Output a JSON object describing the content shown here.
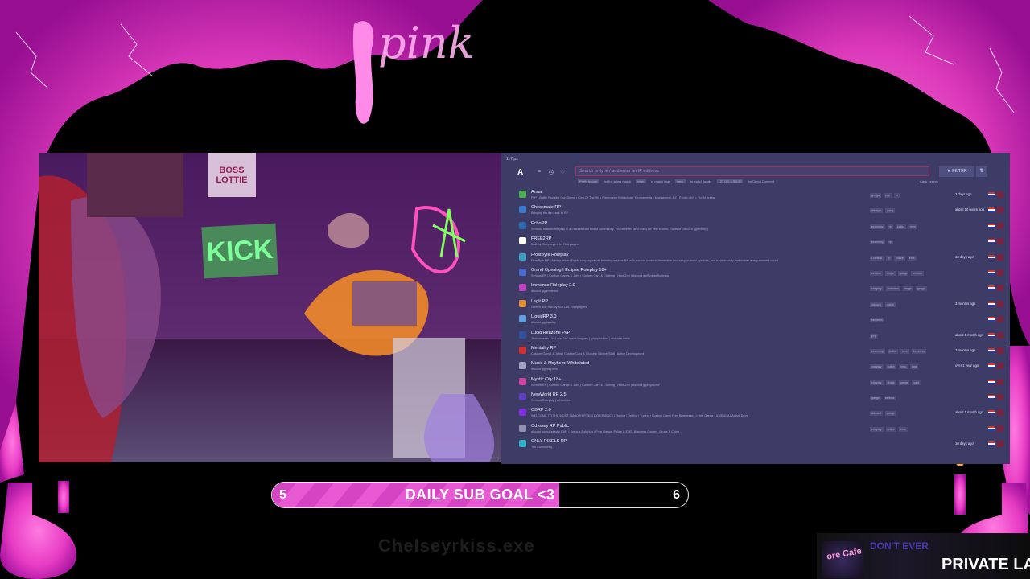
{
  "panel": {
    "fps_text": "117fps",
    "logo_glyph": "A",
    "search_placeholder": "Search or type / and enter an IP address",
    "hint_1_key": "Prefix ip:port",
    "hint_1_text": "for full string match",
    "hint_2_key": "tags:",
    "hint_2_text": "to match tags",
    "hint_3_key": "lang:",
    "hint_3_text": "to match locale",
    "hint_4_key": "127.0.0.1:30120",
    "hint_4_text": "for Direct Connect",
    "clear_label": "Clear search",
    "filter_label": "▼ FILTER",
    "sort_glyph": "⇅"
  },
  "servers": [
    {
      "name": "Arma",
      "desc": "PvP • Battle Royale • Gun Game • King Of The Hill • Freeroam • Extraction • Tournaments • Minigames • RZ • Exotic • KR • FiveM Arena",
      "tags": [
        "gunga",
        "pvp",
        "br"
      ],
      "time": "2 days ago",
      "color": "#4caf50"
    },
    {
      "name": "Checkmate RP",
      "desc": "Bringing the fun back to RP",
      "tags": [
        "lifestyle",
        "gang"
      ],
      "time": "about 10 hours ago",
      "color": "#3a7ad0"
    },
    {
      "name": "EchoRP",
      "desc": "Serious, realistic roleplay in an established FiveM community. You're vetted and ready for new stories. Roots of (discord.gg/echorp)",
      "tags": [
        "economy",
        "rp",
        "police",
        "ems"
      ],
      "time": "",
      "color": "#2a6ab0"
    },
    {
      "name": "FREE2RP",
      "desc": "Built by Roleplayers for Roleplayers",
      "tags": [
        "economy",
        "rp"
      ],
      "time": "",
      "color": "#ffffff"
    },
    {
      "name": "FrostByte Roleplay",
      "desc": "FrostByte RP | A story-driven FiveM roleplay server blending serious RP with custom content. Immersive economy, custom systems, and a community that makes every moment count",
      "tags": [
        "Criminal",
        "rp",
        "police",
        "ems"
      ],
      "time": "13 days ago",
      "color": "#3aa0c0"
    },
    {
      "name": "Grand OpeningII Eclipse Roleplay 18+",
      "desc": "Serious RP | Custom Gangs & Jobs | Custom Cars & Clothing | Hunt Zon | discord.gg/EclipseRoleplay",
      "tags": [
        "serious",
        "drugs",
        "gangs",
        "serious"
      ],
      "time": "",
      "color": "#4a6ad0"
    },
    {
      "name": "Immense Roleplay 2.0",
      "desc": "discord.gg/immense",
      "tags": [
        "roleplay",
        "business",
        "drugs",
        "gangs"
      ],
      "time": "",
      "color": "#c040c0"
    },
    {
      "name": "Legit RP",
      "desc": "Owned and Ran by ACTUAL Roleplayers",
      "tags": [
        "discord",
        "police"
      ],
      "time": "3 months ago",
      "color": "#e09030"
    },
    {
      "name": "LiquidRP 3.0",
      "desc": "discord.gg/liquidrp",
      "tags": [
        "fair rules"
      ],
      "time": "",
      "color": "#60a0e0"
    },
    {
      "name": "Lucid Redzone PvP",
      "desc": "Tournaments | 1v1 and 2v2 arena leagues | fps optimized | redzone meta",
      "tags": [
        "pvp"
      ],
      "time": "about 1 month ago",
      "color": "#3050a0"
    },
    {
      "name": "Mentality RP",
      "desc": "Custom Gangs & Jobs | Custom Cars & Clothing | Active Staff | Active Development",
      "tags": [
        "economy",
        "police",
        "ems",
        "business"
      ],
      "time": "3 months ago",
      "color": "#d03030"
    },
    {
      "name": "Music & Mayhem: Whitelisted",
      "desc": "discord.gg/mayhem",
      "tags": [
        "roleplay",
        "police",
        "ems",
        "jobs"
      ],
      "time": "over 1 year ago",
      "color": "#a0a0c0"
    },
    {
      "name": "Mystic City 18+",
      "desc": "Serious RP | Custom Gangs & Jobs | Custom Cars & Clothing | Hunt Zon | discord.gg/MysticRP",
      "tags": [
        "roleplay",
        "drugs",
        "gangs",
        "cars"
      ],
      "time": "",
      "color": "#d040a0"
    },
    {
      "name": "NewWorld RP 2.5",
      "desc": "Serious Roleplay | Whitelisted",
      "tags": [
        "gangs",
        "serious"
      ],
      "time": "",
      "color": "#6040c0"
    },
    {
      "name": "OBRP 2.0",
      "desc": "WELCOME TO THE MOST SMOOTH FIVEM EXPERIENCE | Racing | Drifting | Tuning | Custom Cars | Free Businesses | Free Gangs | US/EUNA | Active Devs",
      "tags": [
        "discord",
        "gangs"
      ],
      "time": "about 1 month ago",
      "color": "#8030e0"
    },
    {
      "name": "Odyssey RP Public",
      "desc": "discord.gg/odysseyrp | 18+ | Serious Roleplay | Free Gangs, Police & EMS, Business Owners, Drugs & Crime",
      "tags": [
        "roleplay",
        "police",
        "ems"
      ],
      "time": "",
      "color": "#9090b0"
    },
    {
      "name": "ONLY PIXELS RP",
      "desc": "Tiffi Community 1",
      "tags": [],
      "time": "10 days ago",
      "color": "#30b0c0"
    }
  ],
  "goal": {
    "label": "DAILY SUB GOAL <3",
    "current": "5",
    "target": "6",
    "progress_fraction": 0.69
  },
  "decor": {
    "brand_script": "pink",
    "kick_sign": "KICK",
    "boss_sign": "BOSS LOTTIE"
  },
  "overlay": {
    "faded_handle": "Chelseyrkiss.exe",
    "promo_badge": "ore Cafe",
    "promo_line1": "DON'T EVER",
    "promo_line2": "PRIVATE LA"
  }
}
